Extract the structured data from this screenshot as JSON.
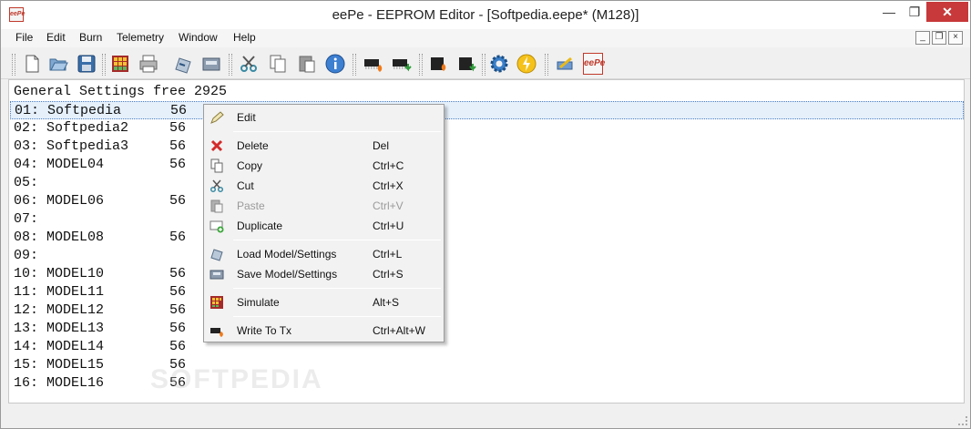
{
  "window": {
    "title": "eePe - EEPROM Editor - [Softpedia.eepe* (M128)]",
    "icon_text": "eePe",
    "min_glyph": "—",
    "max_glyph": "❐",
    "close_glyph": "✕"
  },
  "mdi": {
    "min_glyph": "_",
    "restore_glyph": "❐",
    "close_glyph": "×"
  },
  "menu": [
    "File",
    "Edit",
    "Burn",
    "Telemetry",
    "Window",
    "Help"
  ],
  "toolbar": {
    "icons": [
      "new-file-icon",
      "open-folder-icon",
      "save-disk-icon",
      "simulate-icon",
      "print-icon",
      "load-model-icon",
      "save-model-icon",
      "cut-icon",
      "copy-icon",
      "paste-icon",
      "info-icon",
      "write-to-tx-icon",
      "read-from-tx-icon",
      "write-flash-icon",
      "read-flash-icon",
      "settings-gear-icon",
      "burn-config-icon",
      "customize-icon",
      "eepe-logo-icon"
    ],
    "logo_text": "eePe"
  },
  "content": {
    "general_settings": "General Settings free 2925",
    "models": [
      {
        "num": "01: Softpedia",
        "size": "56",
        "selected": true
      },
      {
        "num": "02: Softpedia2",
        "size": "56"
      },
      {
        "num": "03: Softpedia3",
        "size": "56"
      },
      {
        "num": "04: MODEL04",
        "size": "56"
      },
      {
        "num": "05:",
        "size": ""
      },
      {
        "num": "06: MODEL06",
        "size": "56"
      },
      {
        "num": "07:",
        "size": ""
      },
      {
        "num": "08: MODEL08",
        "size": "56"
      },
      {
        "num": "09:",
        "size": ""
      },
      {
        "num": "10: MODEL10",
        "size": "56"
      },
      {
        "num": "11: MODEL11",
        "size": "56"
      },
      {
        "num": "12: MODEL12",
        "size": "56"
      },
      {
        "num": "13: MODEL13",
        "size": "56"
      },
      {
        "num": "14: MODEL14",
        "size": "56"
      },
      {
        "num": "15: MODEL15",
        "size": "56"
      },
      {
        "num": "16: MODEL16",
        "size": "56"
      }
    ]
  },
  "context_menu": {
    "items": [
      {
        "label": "Edit",
        "shortcut": "",
        "icon": "edit-icon"
      },
      {
        "label": "Delete",
        "shortcut": "Del",
        "icon": "delete-icon"
      },
      {
        "label": "Copy",
        "shortcut": "Ctrl+C",
        "icon": "copy-icon"
      },
      {
        "label": "Cut",
        "shortcut": "Ctrl+X",
        "icon": "cut-icon"
      },
      {
        "label": "Paste",
        "shortcut": "Ctrl+V",
        "icon": "paste-icon",
        "disabled": true
      },
      {
        "label": "Duplicate",
        "shortcut": "Ctrl+U",
        "icon": "duplicate-icon"
      },
      {
        "label": "Load Model/Settings",
        "shortcut": "Ctrl+L",
        "icon": "load-model-icon"
      },
      {
        "label": "Save Model/Settings",
        "shortcut": "Ctrl+S",
        "icon": "save-model-icon"
      },
      {
        "label": "Simulate",
        "shortcut": "Alt+S",
        "icon": "simulate-icon"
      },
      {
        "label": "Write To Tx",
        "shortcut": "Ctrl+Alt+W",
        "icon": "write-to-tx-icon"
      }
    ]
  },
  "colors": {
    "close_button": "#c7393a",
    "selection_bg": "#e5f0fb",
    "selection_border": "#4f7fc0",
    "logo_red": "#c0392b"
  }
}
